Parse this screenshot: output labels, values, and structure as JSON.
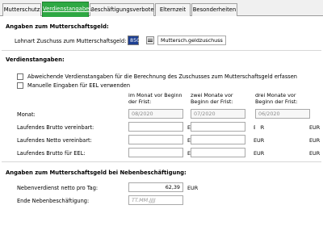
{
  "tabs": [
    {
      "label": "Mutterschutz",
      "active": false
    },
    {
      "label": "Verdienstangaben",
      "active": true
    },
    {
      "label": "Beschäftigungsverbote",
      "active": false
    },
    {
      "label": "Elternzeit",
      "active": false
    },
    {
      "label": "Besonderheiten",
      "active": false
    }
  ],
  "section1": {
    "title": "Angaben zum Mutterschaftsgeld:",
    "lohnart_label": "Lohnart Zuschuss zum Mutterschaftsgeld:",
    "lohnart_code": "850",
    "lohnart_name": "Muttersch.geldzuschuss"
  },
  "section2": {
    "title": "Verdienstangaben:",
    "checkbox1_label": "Abweichende Verdienstangaben für die Berechnung des Zuschusses zum Mutterschaftsgeld erfassen",
    "checkbox2_label": "Manuelle Eingaben für EEL verwenden",
    "col_headers": [
      "im Monat vor Beginn der Frist:",
      "zwei Monate vor Beginn der Frist:",
      "drei Monate vor Beginn der Frist:"
    ],
    "currency": "EUR",
    "rows": [
      {
        "label": "Monat:",
        "values": [
          "08/2020",
          "07/2020",
          "06/2020"
        ]
      },
      {
        "label": "Laufendes Brutto vereinbart:",
        "values": [
          "",
          "",
          ""
        ]
      },
      {
        "label": "Laufendes Netto vereinbart:",
        "values": [
          "",
          "",
          ""
        ]
      },
      {
        "label": "Laufendes Brutto für EEL:",
        "values": [
          "",
          "",
          ""
        ]
      }
    ]
  },
  "section3": {
    "title": "Angaben zum Mutterschaftsgeld bei Nebenbeschäftigung:",
    "nebenverdienst_label": "Nebenverdienst netto pro Tag:",
    "nebenverdienst_value": "62,39",
    "nebenverdienst_currency": "EUR",
    "ende_label": "Ende Nebenbeschäftigung:",
    "ende_placeholder": "TT.MM.JJJJ"
  },
  "colors": {
    "active_tab": "#2ea843",
    "code_highlight": "#1d3f91"
  }
}
